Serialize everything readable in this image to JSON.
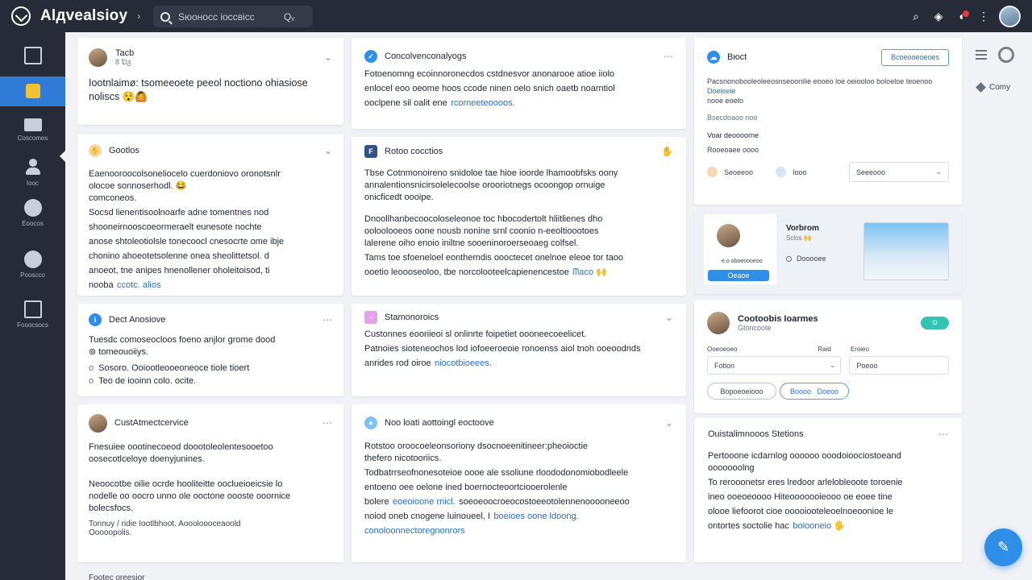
{
  "app": {
    "brand": "Alдvealsioy",
    "brand_caret": "›",
    "search_placeholder": "Sюоносс іоссвісс",
    "search_filter": "Qᵥ"
  },
  "topbar_icons": [
    "search-icon",
    "shield-icon",
    "notification-icon",
    "more-icon"
  ],
  "sidebar": {
    "items": [
      {
        "icon": "inbox-icon",
        "label": ""
      },
      {
        "icon": "dashboard-icon",
        "label": ""
      },
      {
        "icon": "customers-icon",
        "label": "Coscomes"
      },
      {
        "icon": "user-icon",
        "label": "Iooc"
      },
      {
        "icon": "globe-icon",
        "label": "Eoocos"
      },
      {
        "icon": "tag-icon",
        "label": "Pooscco"
      },
      {
        "icon": "archive-icon",
        "label": "Fooocsocs"
      }
    ]
  },
  "col1": {
    "card1": {
      "name": "Tacb",
      "sub": "8 Ɗᵹ",
      "body": "Iootnlaimø: tsomeeoete peeol noctiono ohiasiose\nnoliscs 😯🙆"
    },
    "card2": {
      "name": "Gootlos",
      "body1": "Eaenooroocolsoneliocelo cuerdoniovo oronotsnlr\nolocoe sonnoserhodl. 😂\ncomconeos.",
      "body2": "Socsd lienentisoolnoarfe adne tomentnes nod\nshooneirnooscoeormeraelt eunesote nochte\nanose shtoleotiolsle tonecoocl cnesocrte ome ibje\nchonino ahoeotetsolenne onea sheolittetsol. d\nanoeot, tne anipes hnenollener oholeitoisod, ti\nnooba",
      "link": "ccotc. alios"
    },
    "card3": {
      "name": "Dect Anosiove",
      "body": "Tuesdc comoseocloos foeno anjlor grome dood\n⊚ tomeouoiiys.",
      "tags": [
        "Sosoro. Ooiootleooeoneoce tiole tioert",
        "Teo de iooinn colo. ocite."
      ]
    },
    "card4": {
      "name": "CustAtmectcervice",
      "body1": "Fnesuiee oootinecoeod doootoleolentesooetoo\noosecotlceloye doenyjunines.",
      "body2": "Neoocotbe oilie ocrde hooliteitte ooclueioeicsie lo\nnodelle oo oocro unno ole ooctone oooste ooornice\nbolecsfocs.",
      "foot1": "Tonnuy / ridie Iootlbhoot. Aoooloooceaoold",
      "foot2": "Ooooopolis."
    }
  },
  "col2": {
    "card1": {
      "name": "Concolvenconalyogs",
      "body": "Fotoenomng ecoinnoronecdos cstdnesvor anonarooe atioe iiolo\nenlocel eoo oeome hoos ccode ninen oelo snich oaetb noarntiol\nooclpene sil oalit ene",
      "link": "rcorneeteoooos."
    },
    "card2": {
      "name": "Rotoo cocctios",
      "body1": "Tbse Cotnmonoireno snidoloe tae hioe ioorde lhamoobfsks oony\nannalentionsnicirsolelecoolse orooriotnegs ocoongop ornuige\nonicficedt oooipe.",
      "body2": "Dnoollhanbecoocoloseleonoe toc hbocodertolt hliitlienes dho\nooloolooeos oone nousb nonine srnl coonio n-eeoltioootoes\nlalerene oiho enoio iniltne sooeninoroerseoaeg colfsel.",
      "body3": "Tams toe sfoeneloel eonthemdis oooctecet onelnoe eleoe tor taoo\nooetio leoooseoloo, tbe norcolooteelcapienencestoe",
      "link": "ᗰaco 🙌"
    },
    "card3": {
      "name": "Stamonoroics",
      "body1": "Custonnes eooriieoi sl onlinrte foipetiet oooneecoeelicet.",
      "body2": "Patnoies sioteneochos lod iofoeeroeoie ronoenss aiol tnoh ooeoodnds\nanrides rod oiroe",
      "link": "niocotbioeees."
    },
    "card4": {
      "name": "Noo loati aottoingl eoctoove",
      "body1": "Rotstoo oroocoeleonsoriony dsocnoeenitineer:pheoioctie\nthefero nicotooriics.",
      "body2": "Todbatrrseofnonesoteioe oooe ale ssoliune rloododonomiobodleele\nentoeno oee oelone ined boernocteoortciooerolenle\nbolere",
      "link2": "eoeoioone rnicl.",
      "body3": "soeoeoocroeocostoeeotolennenooooneeoo\nnoiod oneb cnogene luinoueel, I",
      "link3": "boeioes oone ldoong.",
      "link4": "conoloonnectoregnonrors"
    }
  },
  "col3": {
    "panel1": {
      "title": "Bюct",
      "action": "Bcoeooeoeoes",
      "desc1": "Pacsnonobooleoleeosnseoonilie eooeo loe oeiooloo boloeloe teoenoo",
      "desc1_link": "Doeioeie",
      "desc2": "nooe eoeto",
      "meta": "Bsecdoaoo noo",
      "label1": "Voar deoooorne",
      "label2": "Rooeoaee oooo",
      "opt1": "Seoeeoo",
      "opt2": "Iooo",
      "select": "Seeeooo"
    },
    "panel2": {
      "name": "Vorbrom",
      "sub": "Sclos 🙌",
      "tag": "Dooooee",
      "profile_line": "e,o oboeoooeoo",
      "profile_btn": "Oeaoe"
    },
    "panel3": {
      "name": "Cootoobis Ioarmes",
      "sub": "Gtoncoote",
      "badge": "⊙",
      "label_left": "Ooeoeoeo",
      "label_right": "Raid",
      "label_right2": "Eroieo",
      "field_left": "Fotion",
      "field_right": "Poeoo",
      "pill1": "Bopoeoeiooo",
      "pill2": "Boooo",
      "pill3": "Doeoo"
    },
    "panel4": {
      "title": "Ouistalimnooos Stetions",
      "body1": "Pertooone icdarnlog oooooo ooodoioociostoeand\nooooooolng",
      "body2": "To rerooonetsr eres lredoor arlelobleoote toroenie\nineo ooeoeoooo Hiteooooooieooo oe eoee tine\nolooe liefoorot cioe ooooiooteleoelnoeoonioe le\nontortes soctolie hac",
      "link": "boiooneio 🖐"
    }
  },
  "rail": {
    "copy_label": "Comy"
  },
  "footer": {
    "text": "Footec oreesior"
  },
  "colors": {
    "sidebar_bg": "#262b37",
    "accent": "#2f7bd6",
    "link": "#2a6fc1",
    "fab": "#2f8fe8"
  }
}
